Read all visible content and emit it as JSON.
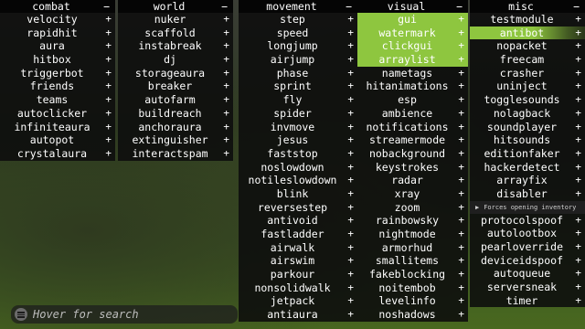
{
  "panels": [
    {
      "title": "combat",
      "header_icon": "−",
      "items": [
        {
          "label": "velocity"
        },
        {
          "label": "rapidhit"
        },
        {
          "label": "aura"
        },
        {
          "label": "hitbox"
        },
        {
          "label": "triggerbot"
        },
        {
          "label": "friends"
        },
        {
          "label": "teams"
        },
        {
          "label": "autoclicker"
        },
        {
          "label": "infiniteaura"
        },
        {
          "label": "autopot"
        },
        {
          "label": "crystalaura"
        }
      ]
    },
    {
      "title": "world",
      "header_icon": "−",
      "items": [
        {
          "label": "nuker"
        },
        {
          "label": "scaffold"
        },
        {
          "label": "instabreak"
        },
        {
          "label": "dj"
        },
        {
          "label": "storageaura"
        },
        {
          "label": "breaker"
        },
        {
          "label": "autofarm"
        },
        {
          "label": "buildreach"
        },
        {
          "label": "anchoraura"
        },
        {
          "label": "extinguisher"
        },
        {
          "label": "interactspam"
        }
      ]
    },
    {
      "title": "movement",
      "header_icon": "−",
      "items": [
        {
          "label": "step"
        },
        {
          "label": "speed"
        },
        {
          "label": "longjump"
        },
        {
          "label": "airjump"
        },
        {
          "label": "phase"
        },
        {
          "label": "sprint"
        },
        {
          "label": "fly"
        },
        {
          "label": "spider"
        },
        {
          "label": "invmove"
        },
        {
          "label": "jesus"
        },
        {
          "label": "faststop"
        },
        {
          "label": "noslowdown"
        },
        {
          "label": "notileslowdown"
        },
        {
          "label": "blink"
        },
        {
          "label": "reversestep"
        },
        {
          "label": "antivoid"
        },
        {
          "label": "fastladder"
        },
        {
          "label": "airwalk"
        },
        {
          "label": "airswim"
        },
        {
          "label": "parkour"
        },
        {
          "label": "nonsolidwalk"
        },
        {
          "label": "jetpack"
        },
        {
          "label": "antiaura"
        }
      ]
    },
    {
      "title": "visual",
      "header_icon": "−",
      "items": [
        {
          "label": "gui",
          "enabled": true
        },
        {
          "label": "watermark",
          "enabled": true
        },
        {
          "label": "clickgui",
          "enabled": true
        },
        {
          "label": "arraylist",
          "enabled": true
        },
        {
          "label": "nametags"
        },
        {
          "label": "hitanimations"
        },
        {
          "label": "esp"
        },
        {
          "label": "ambience"
        },
        {
          "label": "notifications"
        },
        {
          "label": "streamermode"
        },
        {
          "label": "nobackground"
        },
        {
          "label": "keystrokes"
        },
        {
          "label": "radar"
        },
        {
          "label": "xray"
        },
        {
          "label": "zoom"
        },
        {
          "label": "rainbowsky"
        },
        {
          "label": "nightmode"
        },
        {
          "label": "armorhud"
        },
        {
          "label": "smallitems"
        },
        {
          "label": "fakeblocking"
        },
        {
          "label": "noitembob"
        },
        {
          "label": "levelinfo"
        },
        {
          "label": "noshadows"
        }
      ]
    },
    {
      "title": "misc",
      "header_icon": "−",
      "items": [
        {
          "label": "testmodule"
        },
        {
          "label": "antibot",
          "enabled": true
        },
        {
          "label": "nopacket"
        },
        {
          "label": "freecam"
        },
        {
          "label": "crasher"
        },
        {
          "label": "uninject"
        },
        {
          "label": "togglesounds"
        },
        {
          "label": "nolagback"
        },
        {
          "label": "soundplayer"
        },
        {
          "label": "hitsounds"
        },
        {
          "label": "editionfaker"
        },
        {
          "label": "hackerdetect"
        },
        {
          "label": "arrayfix"
        },
        {
          "label": "disabler"
        }
      ],
      "tooltip": "Forces opening inventory",
      "items_after": [
        {
          "label": "protocolspoof"
        },
        {
          "label": "autolootbox"
        },
        {
          "label": "pearloverride"
        },
        {
          "label": "deviceidspoof"
        },
        {
          "label": "autoqueue"
        },
        {
          "label": "serversneak"
        },
        {
          "label": "timer"
        }
      ]
    }
  ],
  "row_icon": "+",
  "search": {
    "placeholder": "Hover for search",
    "icon": "menu-icon"
  },
  "colors": {
    "enabled": "#8ec63f",
    "panel_bg": "#0c0c0c",
    "text": "#ffffff"
  }
}
